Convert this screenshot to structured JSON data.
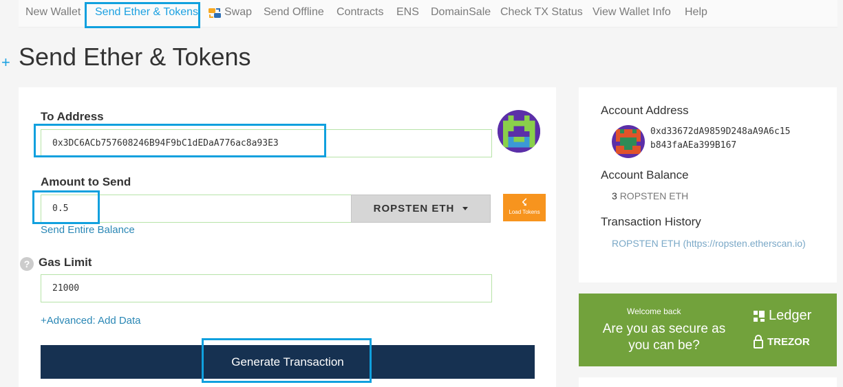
{
  "nav": {
    "items": [
      {
        "label": "New Wallet"
      },
      {
        "label": "Send Ether & Tokens"
      },
      {
        "label": "Swap"
      },
      {
        "label": "Send Offline"
      },
      {
        "label": "Contracts"
      },
      {
        "label": "ENS"
      },
      {
        "label": "DomainSale"
      },
      {
        "label": "Check TX Status"
      },
      {
        "label": "View Wallet Info"
      },
      {
        "label": "Help"
      }
    ],
    "active": "Send Ether & Tokens"
  },
  "page": {
    "plus": "+",
    "title": "Send Ether & Tokens"
  },
  "form": {
    "to_label": "To Address",
    "to_value": "0x3DC6ACb757608246B94F9bC1dEDaA776ac8a93E3",
    "amount_label": "Amount to Send",
    "amount_value": "0.5",
    "currency": "ROPSTEN ETH",
    "load_tokens": "Load Tokens",
    "send_entire": "Send Entire Balance",
    "gas_label": "Gas Limit",
    "gas_value": "21000",
    "advanced": "+Advanced: Add Data",
    "generate": "Generate Transaction",
    "help": "?"
  },
  "sidebar": {
    "account_address_label": "Account Address",
    "account_address_line1": "0xd33672dA9859D248aA9A6c15",
    "account_address_line2": "b843faAEa399B167",
    "balance_label": "Account Balance",
    "balance_value": "3",
    "balance_unit": "ROPSTEN ETH",
    "history_label": "Transaction History",
    "history_link": "ROPSTEN ETH (https://ropsten.etherscan.io)"
  },
  "promo": {
    "welcome": "Welcome back",
    "question": "Are you as secure as you can be?",
    "brand1": "Ledger",
    "brand2": "TREZOR"
  },
  "colors": {
    "accent": "#1ca1e1",
    "button": "#163151",
    "promo": "#72a23c",
    "load": "#f7941e"
  }
}
